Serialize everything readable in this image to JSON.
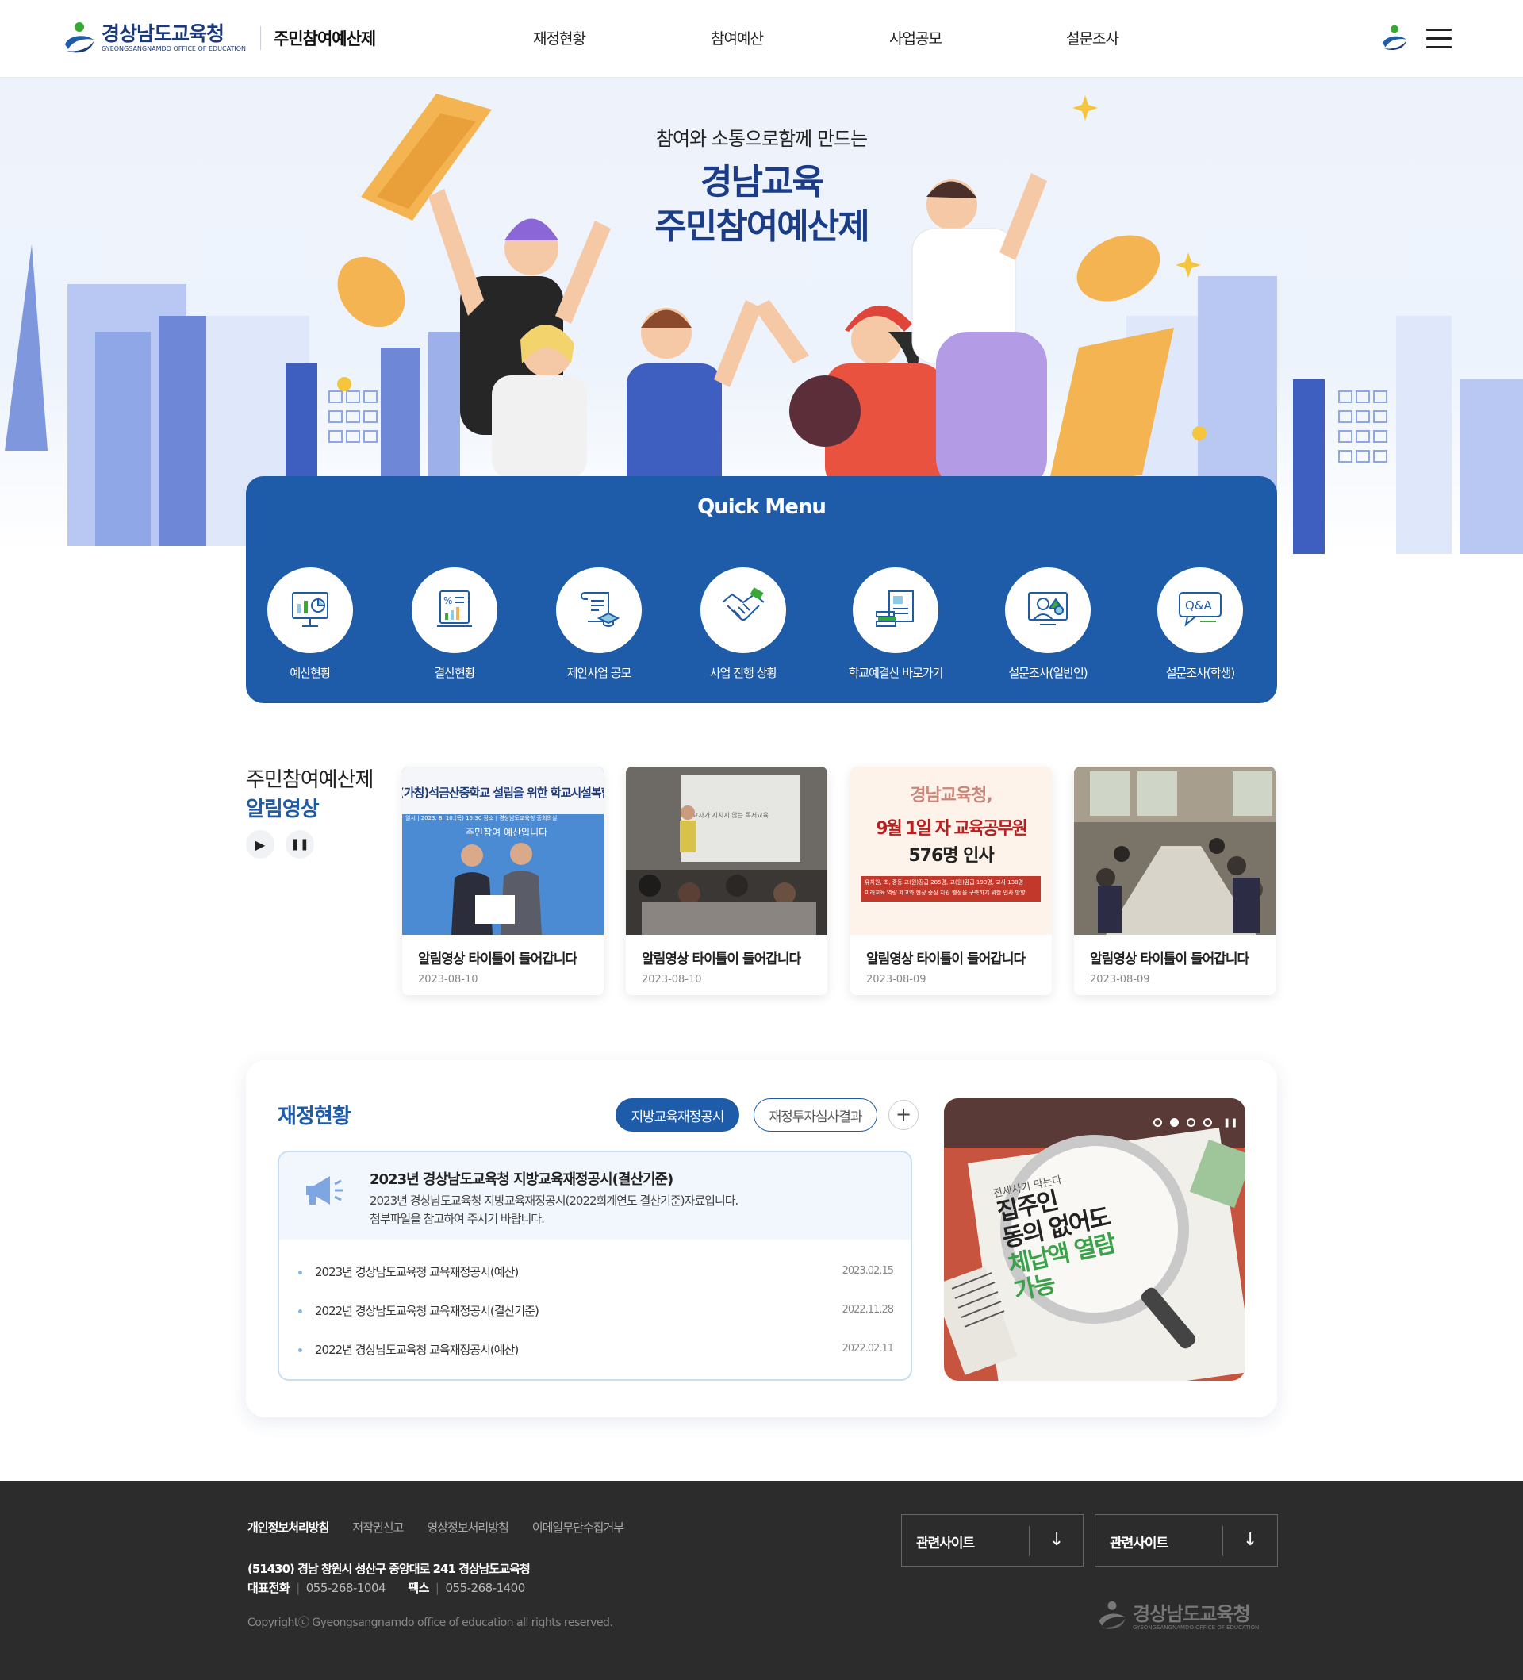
{
  "header": {
    "logo_ko": "경상남도교육청",
    "logo_en": "GYEONGSANGNAMDO OFFICE OF EDUCATION",
    "site_title": "주민참여예산제",
    "nav": [
      "재정현황",
      "참여예산",
      "사업공모",
      "설문조사"
    ]
  },
  "hero": {
    "subtitle": "참여와 소통으로함께 만드는",
    "title_line1": "경남교육",
    "title_line2": "주민참여예산제"
  },
  "quick_menu": {
    "title": "Quick Menu",
    "items": [
      {
        "label": "예산현황",
        "icon": "presentation-chart-icon"
      },
      {
        "label": "결산현황",
        "icon": "report-chart-icon"
      },
      {
        "label": "제안사업 공모",
        "icon": "scroll-graduation-icon"
      },
      {
        "label": "사업 진행 상황",
        "icon": "handshake-icon"
      },
      {
        "label": "학교예결산 바로가기",
        "icon": "documents-icon"
      },
      {
        "label": "설문조사(일반인)",
        "icon": "person-survey-icon"
      },
      {
        "label": "설문조사(학생)",
        "icon": "qa-bubble-icon"
      }
    ]
  },
  "videos": {
    "heading1": "주민참여예산제",
    "heading2": "알림영상",
    "items": [
      {
        "title": "알림영상 타이틀이 들어갑니다",
        "date": "2023-08-10",
        "banner": "(가칭)석금산중학교 설립을 위한 학교시설복합화 ·",
        "banner_sub": "일시 | 2023. 8. 10.(목) 15:30   장소 | 경상남도교육청 중회의실",
        "banner2": "주민참여 예산입니다"
      },
      {
        "title": "알림영상 타이틀이 들어갑니다",
        "date": "2023-08-10",
        "screen": "교사가 지치지 않는 독서교육"
      },
      {
        "title": "알림영상 타이틀이 들어갑니다",
        "date": "2023-08-09",
        "poster_h": "경남교육청,",
        "poster_l1": "9월 1일 자 교육공무원",
        "poster_l2": "576명 인사",
        "poster_s1": "유치원, 초, 중등 교(원)장급 285명, 교(원)감급 193명, 교사 138명",
        "poster_s2": "미래교육 역량 제고와 현장 중심 지원 행정을 구축하기 위한 인사 방향"
      },
      {
        "title": "알림영상 타이틀이 들어갑니다",
        "date": "2023-08-09"
      }
    ]
  },
  "finance": {
    "title": "재정현황",
    "tabs": [
      "지방교육재정공시",
      "재정투자심사결과"
    ],
    "plus": "+",
    "featured": {
      "title": "2023년 경상남도교육청 지방교육재정공시(결산기준)",
      "desc1": "2023년 경상남도교육청 지방교육재정공시(2022회계연도 결산기준)자료입니다.",
      "desc2": "첨부파일을 참고하여 주시기 바랍니다."
    },
    "rows": [
      {
        "title": "2023년 경상남도교육청 교육재정공시(예산)",
        "date": "2023.02.15"
      },
      {
        "title": "2022년 경상남도교육청 교육재정공시(결산기준)",
        "date": "2022.11.28"
      },
      {
        "title": "2022년 경상남도교육청 교육재정공시(예산)",
        "date": "2022.02.11"
      }
    ],
    "banner": {
      "small": "전세사기 막는다",
      "line1": "집주인",
      "line2": "동의 없어도",
      "line3": "체납액 열람",
      "line4": "가능",
      "page_total": 4,
      "page_active": 2
    }
  },
  "footer": {
    "links": [
      "개인정보처리방침",
      "저작권신고",
      "영상정보처리방침",
      "이메일무단수집거부"
    ],
    "address": "(51430) 경남 창원시 성산구 중앙대로 241 경상남도교육청",
    "tel_label": "대표전화",
    "tel": "055-268-1004",
    "fax_label": "팩스",
    "fax": "055-268-1400",
    "copyright": "Copyrightⓒ Gyeongsangnamdo office of education all rights reserved.",
    "selects": [
      "관련사이트",
      "관련사이트"
    ],
    "logo_ko": "경상남도교육청",
    "logo_en": "GYEONGSANGNAMDO OFFICE OF EDUCATION"
  },
  "colors": {
    "brand": "#1e5ba8",
    "navy": "#1b3d88",
    "footer": "#2c2c2c"
  }
}
